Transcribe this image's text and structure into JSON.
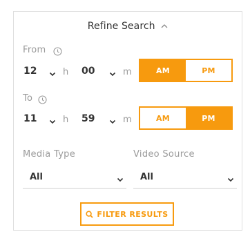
{
  "header": {
    "title": "Refine Search"
  },
  "from": {
    "label": "From",
    "hour": "12",
    "hour_unit": "h",
    "minute": "00",
    "minute_unit": "m",
    "am_label": "AM",
    "pm_label": "PM",
    "selected": "AM"
  },
  "to": {
    "label": "To",
    "hour": "11",
    "hour_unit": "h",
    "minute": "59",
    "minute_unit": "m",
    "am_label": "AM",
    "pm_label": "PM",
    "selected": "PM"
  },
  "media_type": {
    "label": "Media Type",
    "value": "All"
  },
  "video_source": {
    "label": "Video Source",
    "value": "All"
  },
  "filter_button": {
    "label": "FILTER RESULTS",
    "icon": "search-icon"
  },
  "colors": {
    "accent": "#f79a0e",
    "muted_text": "#9a9a9a",
    "border": "#dedede"
  }
}
